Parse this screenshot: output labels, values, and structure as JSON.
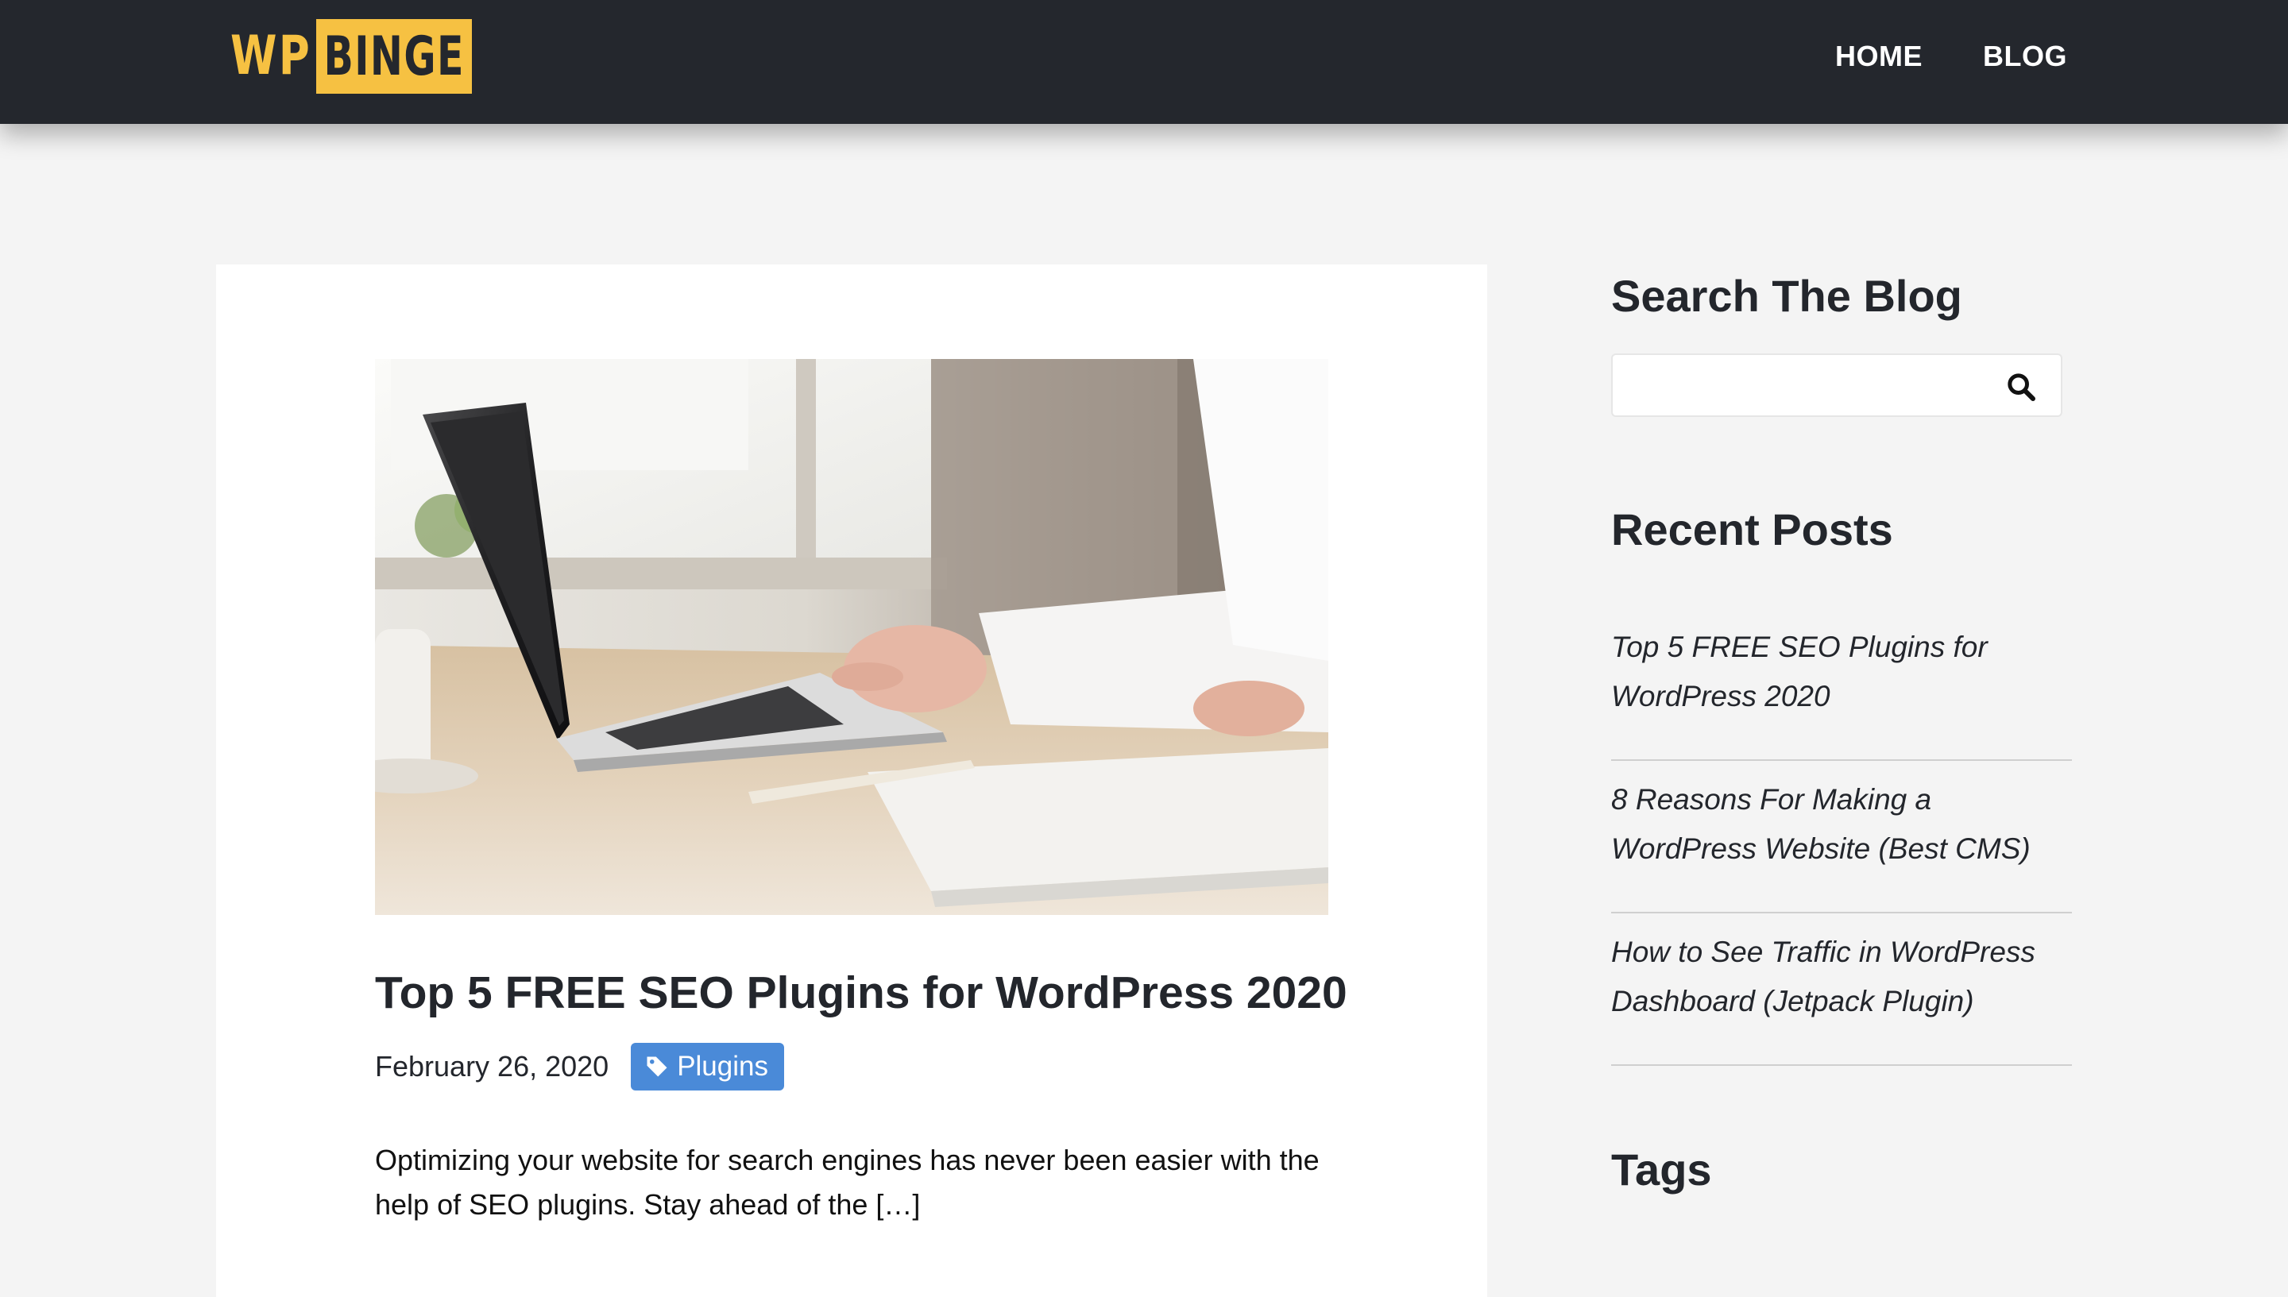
{
  "header": {
    "logo": {
      "part1": "WP",
      "part2": "BINGE"
    },
    "nav": [
      {
        "label": "HOME"
      },
      {
        "label": "BLOG"
      }
    ]
  },
  "post": {
    "image_icon": "laptop-desk-photo",
    "title": "Top 5 FREE SEO Plugins for WordPress 2020",
    "date": "February 26, 2020",
    "tag": {
      "label": "Plugins",
      "icon": "tag-icon"
    },
    "excerpt": "Optimizing your website for search engines has never been easier with the help of SEO plugins. Stay ahead of the […]"
  },
  "sidebar": {
    "search": {
      "title": "Search The Blog",
      "placeholder": "",
      "value": "",
      "icon": "search-icon"
    },
    "recent": {
      "title": "Recent Posts",
      "items": [
        {
          "label": "Top 5 FREE SEO Plugins for WordPress 2020"
        },
        {
          "label": "8 Reasons For Making a WordPress Website (Best CMS)"
        },
        {
          "label": "How to See Traffic in WordPress Dashboard (Jetpack Plugin)"
        }
      ]
    },
    "tags": {
      "title": "Tags"
    }
  },
  "colors": {
    "header_bg": "#24272d",
    "brand_yellow": "#f6c142",
    "badge_blue": "#4a8ad8",
    "page_bg": "#f4f4f4"
  }
}
